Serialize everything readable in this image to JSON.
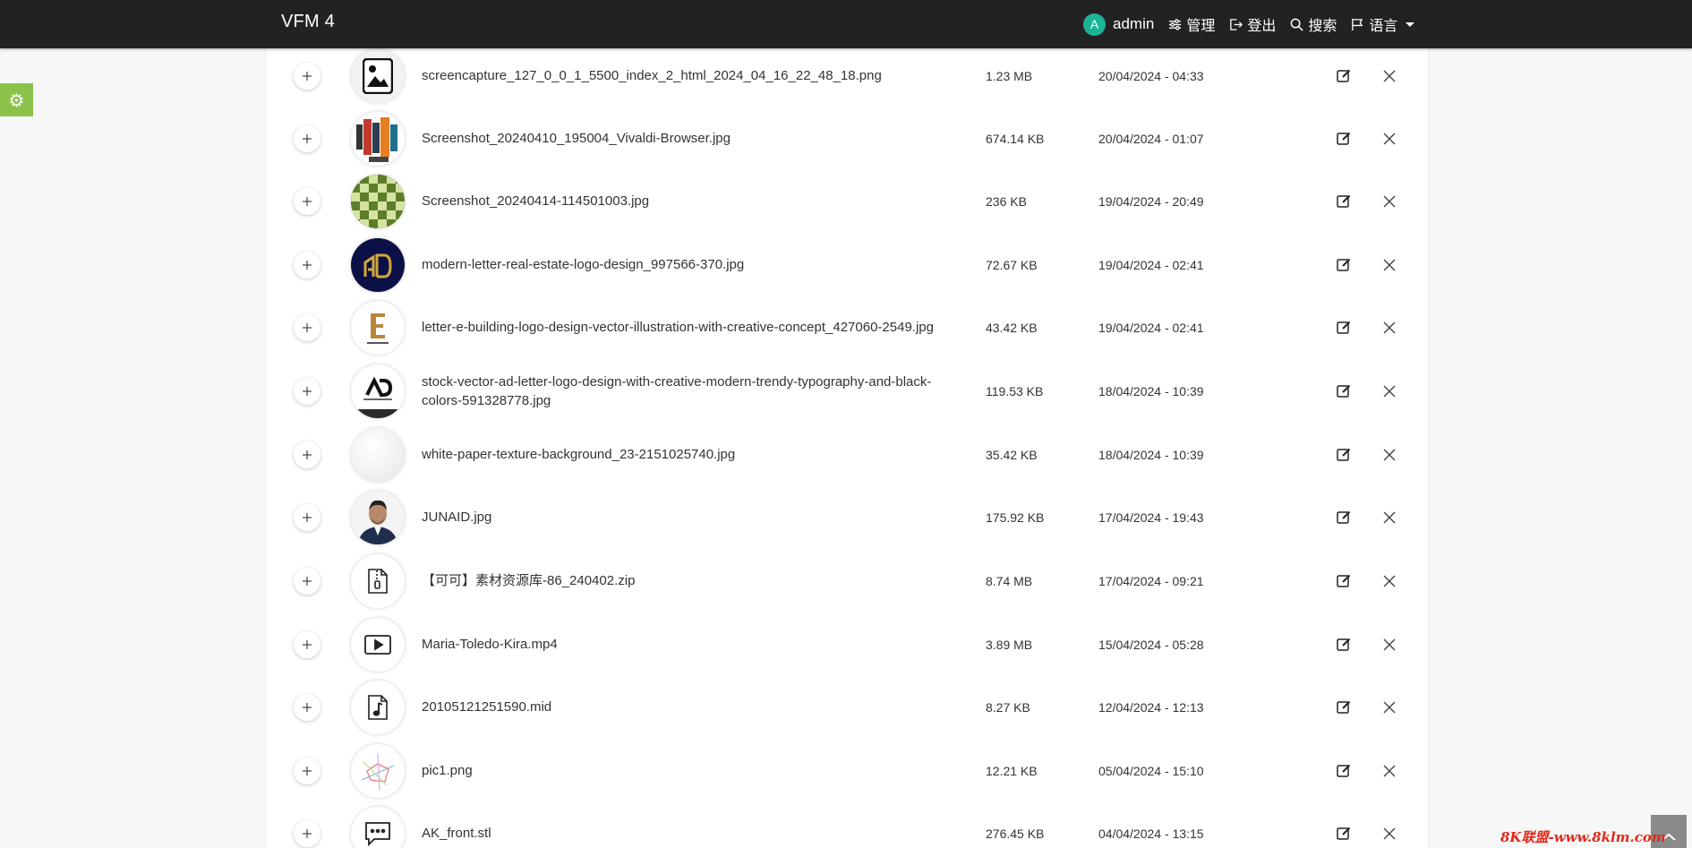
{
  "app": {
    "brand": "VFM 4"
  },
  "nav": {
    "user_initial": "A",
    "user_name": "admin",
    "admin_label": "管理",
    "logout_label": "登出",
    "search_label": "搜索",
    "language_label": "语言"
  },
  "files": [
    {
      "name": "screencapture_127_0_0_1_5500_index_2_html_2024_04_16_22_48_18.png",
      "size": "1.23 MB",
      "date": "20/04/2024 - 04:33",
      "thumb": "image-file-icon"
    },
    {
      "name": "Screenshot_20240410_195004_Vivaldi-Browser.jpg",
      "size": "674.14 KB",
      "date": "20/04/2024 - 01:07",
      "thumb": "image-thumbnail"
    },
    {
      "name": "Screenshot_20240414-114501003.jpg",
      "size": "236 KB",
      "date": "19/04/2024 - 20:49",
      "thumb": "image-thumbnail"
    },
    {
      "name": "modern-letter-real-estate-logo-design_997566-370.jpg",
      "size": "72.67 KB",
      "date": "19/04/2024 - 02:41",
      "thumb": "image-thumbnail"
    },
    {
      "name": "letter-e-building-logo-design-vector-illustration-with-creative-concept_427060-2549.jpg",
      "size": "43.42 KB",
      "date": "19/04/2024 - 02:41",
      "thumb": "image-thumbnail"
    },
    {
      "name": "stock-vector-ad-letter-logo-design-with-creative-modern-trendy-typography-and-black-colors-591328778.jpg",
      "size": "119.53 KB",
      "date": "18/04/2024 - 10:39",
      "thumb": "image-thumbnail"
    },
    {
      "name": "white-paper-texture-background_23-2151025740.jpg",
      "size": "35.42 KB",
      "date": "18/04/2024 - 10:39",
      "thumb": "image-thumbnail"
    },
    {
      "name": "JUNAID.jpg",
      "size": "175.92 KB",
      "date": "17/04/2024 - 19:43",
      "thumb": "image-thumbnail"
    },
    {
      "name": "【可可】素材资源库-86_240402.zip",
      "size": "8.74 MB",
      "date": "17/04/2024 - 09:21",
      "thumb": "zip-file-icon"
    },
    {
      "name": "Maria-Toledo-Kira.mp4",
      "size": "3.89 MB",
      "date": "15/04/2024 - 05:28",
      "thumb": "video-file-icon"
    },
    {
      "name": "20105121251590.mid",
      "size": "8.27 KB",
      "date": "12/04/2024 - 12:13",
      "thumb": "audio-file-icon"
    },
    {
      "name": "pic1.png",
      "size": "12.21 KB",
      "date": "05/04/2024 - 15:10",
      "thumb": "image-thumbnail"
    },
    {
      "name": "AK_front.stl",
      "size": "276.45 KB",
      "date": "04/04/2024 - 13:15",
      "thumb": "generic-file-icon"
    }
  ],
  "watermark": "8K联盟-www.8klm.com",
  "colors": {
    "navbar": "#222222",
    "avatar": "#1bb394",
    "settings_tab": "#8bc34a"
  }
}
